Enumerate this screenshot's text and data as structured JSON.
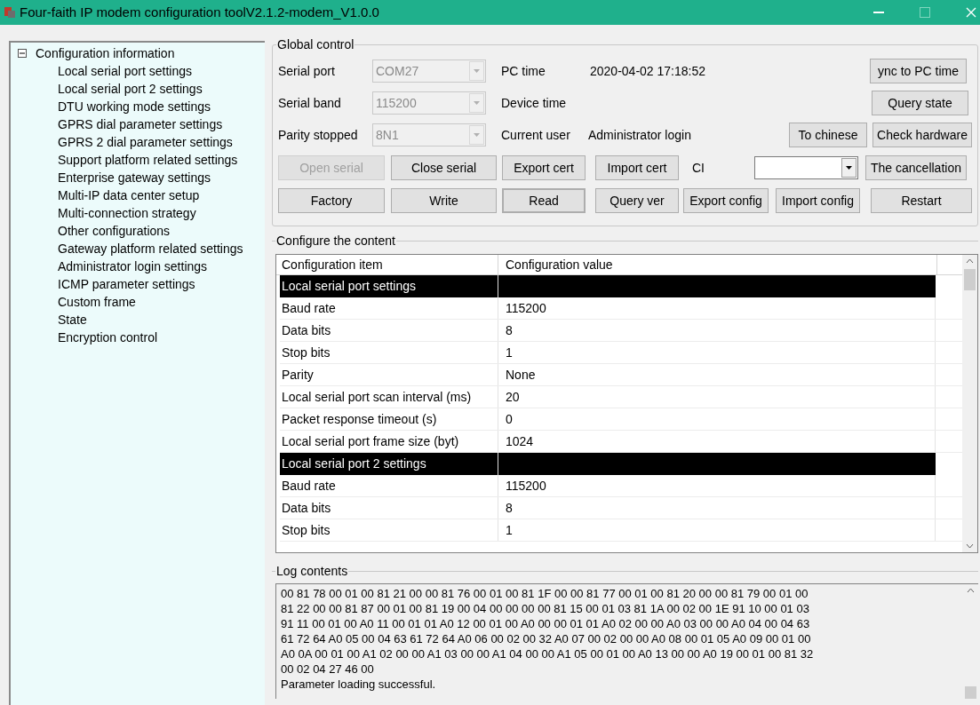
{
  "window": {
    "title": "Four-faith IP modem configuration toolV2.1.2-modem_V1.0.0"
  },
  "tree": {
    "label": "Configuration information",
    "expanded": true,
    "children": [
      {
        "label": "Local serial port settings"
      },
      {
        "label": "Local serial port 2 settings"
      },
      {
        "label": "DTU working mode settings"
      },
      {
        "label": "GPRS dial parameter settings"
      },
      {
        "label": "GPRS 2 dial parameter settings"
      },
      {
        "label": "Support platform related settings"
      },
      {
        "label": "Enterprise gateway settings"
      },
      {
        "label": "Multi-IP data center setup"
      },
      {
        "label": "Multi-connection strategy"
      },
      {
        "label": "Other configurations"
      },
      {
        "label": "Gateway platform related settings"
      },
      {
        "label": "Administrator login settings"
      },
      {
        "label": "ICMP parameter settings"
      },
      {
        "label": "Custom frame"
      },
      {
        "label": "State"
      },
      {
        "label": "Encryption control"
      }
    ]
  },
  "global_control": {
    "title": "Global control",
    "serial_port": {
      "label": "Serial port",
      "value": "COM27",
      "disabled": true
    },
    "serial_band": {
      "label": "Serial band",
      "value": "115200",
      "disabled": true
    },
    "parity_stopped": {
      "label": "Parity stopped",
      "value": "8N1",
      "disabled": true
    },
    "pc_time": {
      "label": "PC time",
      "value": "2020-04-02 17:18:52"
    },
    "device_time": {
      "label": "Device time"
    },
    "current_user": {
      "label": "Current user",
      "value": "Administrator login"
    },
    "ci": {
      "label": "CI"
    },
    "buttons": [
      {
        "label": "ync to PC time",
        "disabled": false,
        "default": false
      },
      {
        "label": "Query state",
        "disabled": false,
        "default": false
      },
      {
        "label": "To chinese",
        "disabled": false,
        "default": false
      },
      {
        "label": "Check hardware",
        "disabled": false,
        "default": false
      },
      {
        "label": "Open serial",
        "disabled": true,
        "default": false
      },
      {
        "label": "Close serial",
        "disabled": false,
        "default": false
      },
      {
        "label": "Export cert",
        "disabled": false,
        "default": false
      },
      {
        "label": "Import cert",
        "disabled": false,
        "default": false
      },
      {
        "label": "The cancellation",
        "disabled": false,
        "default": false
      },
      {
        "label": "Factory",
        "disabled": false,
        "default": false
      },
      {
        "label": "Write",
        "disabled": false,
        "default": false
      },
      {
        "label": "Read",
        "disabled": false,
        "default": true
      },
      {
        "label": "Query ver",
        "disabled": false,
        "default": false
      },
      {
        "label": "Export config",
        "disabled": false,
        "default": false
      },
      {
        "label": "Import config",
        "disabled": false,
        "default": false
      },
      {
        "label": "Restart",
        "disabled": false,
        "default": false
      }
    ]
  },
  "configure": {
    "title": "Configure the content",
    "columns": [
      "Configuration item",
      "Configuration value"
    ],
    "rows": [
      {
        "kind": "section",
        "item": "Local serial port settings"
      },
      {
        "kind": "item",
        "item": "Baud rate",
        "value": "115200"
      },
      {
        "kind": "item",
        "item": "Data bits",
        "value": "8"
      },
      {
        "kind": "item",
        "item": "Stop bits",
        "value": "1"
      },
      {
        "kind": "item",
        "item": "Parity",
        "value": "None"
      },
      {
        "kind": "item",
        "item": "Local serial port scan interval (ms)",
        "value": "20"
      },
      {
        "kind": "item",
        "item": "Packet response timeout (s)",
        "value": "0"
      },
      {
        "kind": "item",
        "item": "Local serial port frame size (byt)",
        "value": "1024"
      },
      {
        "kind": "section",
        "item": "Local serial port 2 settings"
      },
      {
        "kind": "item",
        "item": "Baud rate",
        "value": "115200"
      },
      {
        "kind": "item",
        "item": "Data bits",
        "value": "8"
      },
      {
        "kind": "item",
        "item": "Stop bits",
        "value": "1"
      }
    ]
  },
  "log": {
    "title": "Log contents",
    "lines": [
      "00 81 78 00 01 00 81 21 00 00 81 76 00 01 00 81 1F 00 00 81 77 00 01 00 81 20 00 00 81 79 00 01 00",
      "81 22 00 00 81 87 00 01 00 81 19 00 04 00 00 00 00 81 15 00 01 03 81 1A 00 02 00 1E 91 10 00 01 03",
      "91 11 00 01 00 A0 11 00 01 01 A0 12 00 01 00 A0 00 00 01 01 A0 02 00 00 A0 03 00 00 A0 04 00 04 63",
      "61 72 64 A0 05 00 04 63 61 72 64 A0 06 00 02 00 32 A0 07 00 02 00 00 A0 08 00 01 05 A0 09 00 01 00",
      "A0 0A 00 01 00 A1 02 00 00 A1 03 00 00 A1 04 00 00 A1 05 00 01 00 A0 13 00 00 A0 19 00 01 00 81 32",
      "00 02 04 27 46 00",
      "Parameter loading successful."
    ]
  }
}
